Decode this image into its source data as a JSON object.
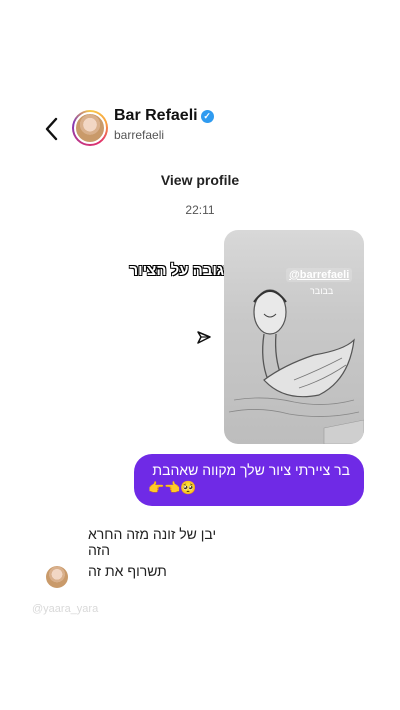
{
  "header": {
    "name": "Bar Refaeli",
    "verified_badge": "✓",
    "handle": "barrefaeli"
  },
  "profile": {
    "view_profile": "View profile"
  },
  "timestamp": "22:11",
  "story_reply": {
    "caption": "התגובה על הציור",
    "mention": "@barrefaeli",
    "subtext": "בבובר"
  },
  "messages": [
    {
      "sender": "me",
      "text": "בר ציירתי ציור שלך מקווה שאהבת",
      "emoji": "👉👈🥺"
    },
    {
      "sender": "them",
      "text": "יבן של זונה מזה החרא הזה"
    },
    {
      "sender": "them",
      "text": "תשרוף את זה"
    }
  ],
  "watermark": "@yaara_yara",
  "colors": {
    "bubble": "#6f2ae6",
    "verified": "#2f9bf0"
  },
  "icons": {
    "back": "chevron-left-icon",
    "share": "paper-plane-icon",
    "verified": "verified-badge-icon"
  }
}
